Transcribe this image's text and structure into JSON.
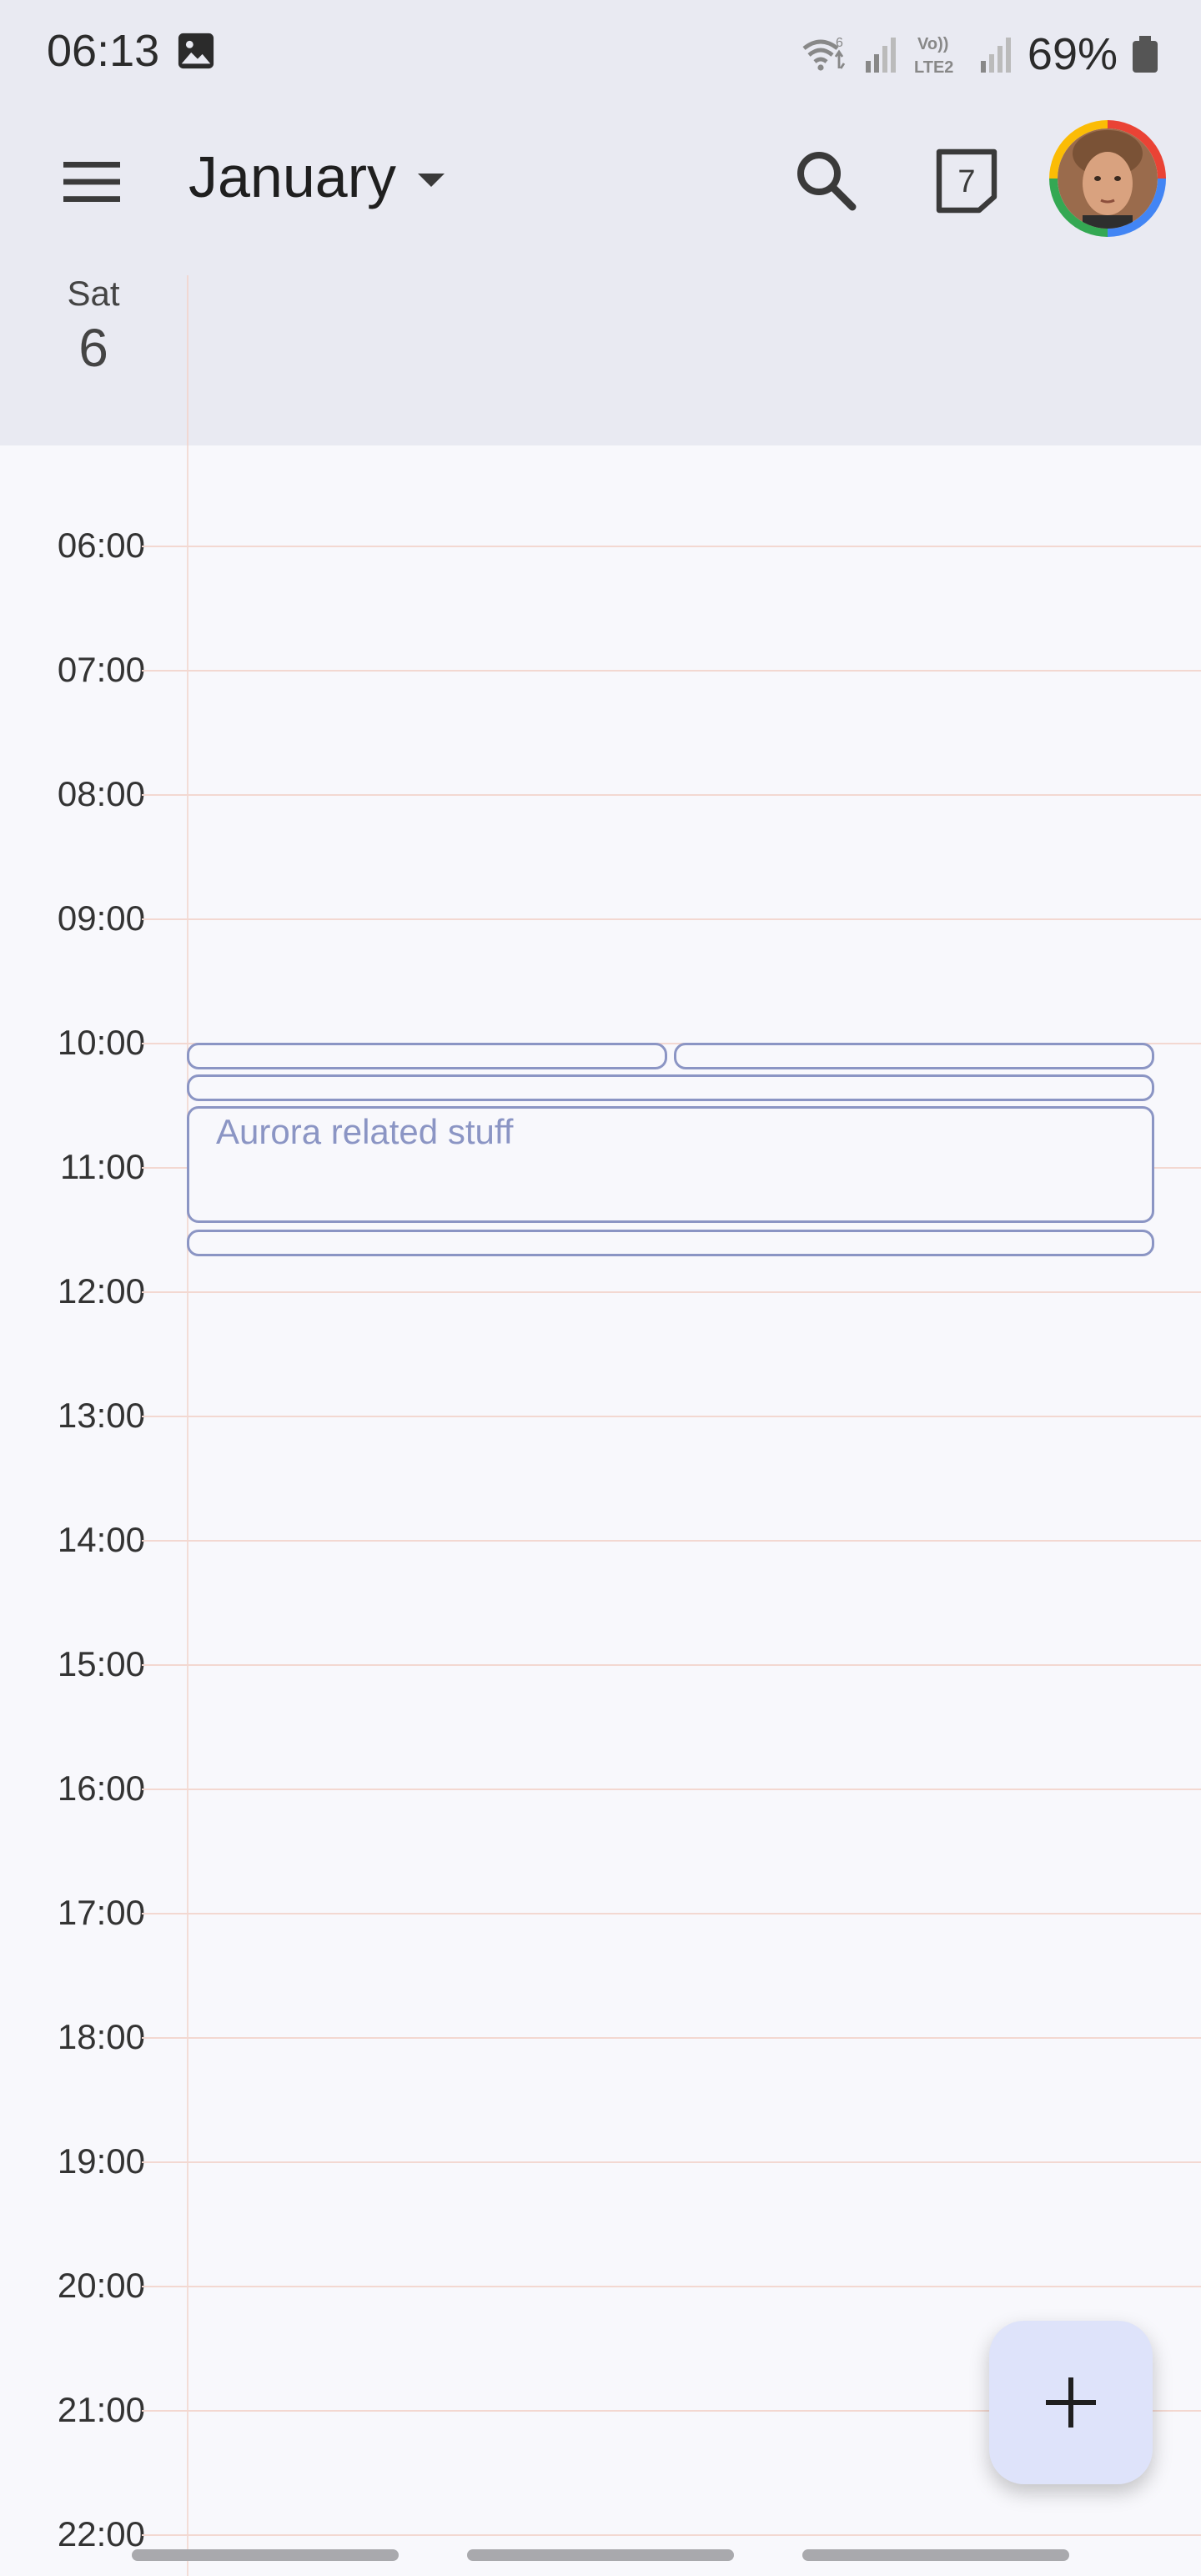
{
  "status_bar": {
    "time": "06:13",
    "battery": "69%",
    "icons": [
      "gallery-icon",
      "wifi-6-icon",
      "signal-icon",
      "volte-lte2-icon",
      "signal-icon",
      "battery-icon"
    ],
    "volte_label": "Vo)) LTE2"
  },
  "app_bar": {
    "month": "January",
    "today_date": "7",
    "icons": [
      "menu-icon",
      "caret-down-icon",
      "search-icon",
      "today-calendar-icon",
      "account-avatar"
    ]
  },
  "day": {
    "name": "Sat",
    "number": "6"
  },
  "timeline": {
    "hours": [
      "06:00",
      "07:00",
      "08:00",
      "09:00",
      "10:00",
      "11:00",
      "12:00",
      "13:00",
      "14:00",
      "15:00",
      "16:00",
      "17:00",
      "18:00",
      "19:00",
      "20:00",
      "21:00",
      "22:00"
    ]
  },
  "events": [
    {
      "title": "",
      "start": "10:00"
    },
    {
      "title": "",
      "start": "10:00"
    },
    {
      "title": "",
      "start": "10:15"
    },
    {
      "title": "Aurora related stuff",
      "start": "10:30",
      "end": "11:30"
    },
    {
      "title": "",
      "start": "11:30"
    }
  ],
  "fab": {
    "icon": "plus-icon"
  },
  "colors": {
    "header_bg": "#e9eaf2",
    "grid_bg": "#f8f8fc",
    "event_outline": "#8b95c4",
    "fab_bg": "#dee3fa"
  }
}
